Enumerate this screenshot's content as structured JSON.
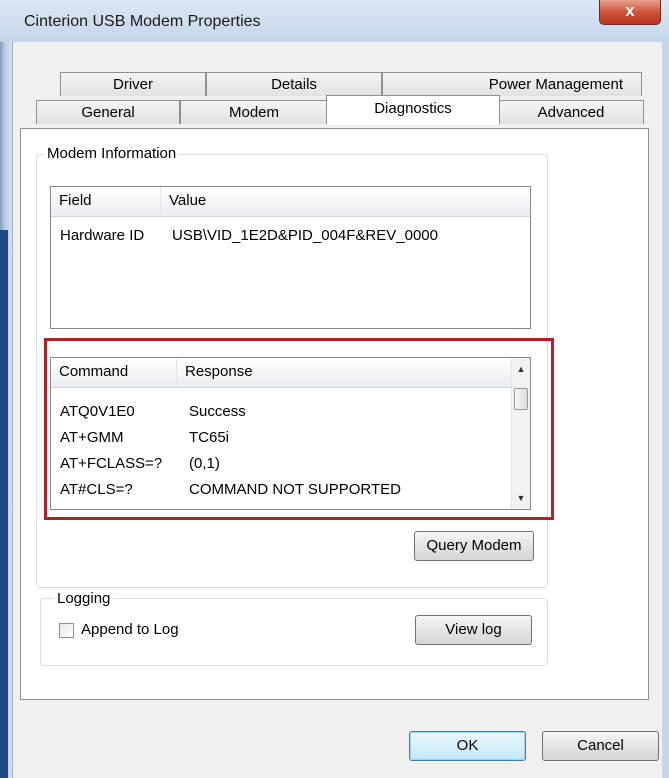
{
  "window": {
    "title": "Cinterion USB Modem Properties",
    "close_glyph": "x"
  },
  "tabs_row1": [
    {
      "label": "Driver"
    },
    {
      "label": "Details"
    },
    {
      "label": "Power Management"
    }
  ],
  "tabs_row2": [
    {
      "label": "General"
    },
    {
      "label": "Modem"
    },
    {
      "label": "Diagnostics"
    },
    {
      "label": "Advanced"
    }
  ],
  "active_tab": "Diagnostics",
  "modem_info": {
    "title": "Modem Information",
    "columns": [
      "Field",
      "Value"
    ],
    "rows": [
      {
        "field": "Hardware ID",
        "value": "USB\\VID_1E2D&PID_004F&REV_0000"
      }
    ]
  },
  "commands": {
    "columns": [
      "Command",
      "Response"
    ],
    "rows": [
      {
        "command": "ATQ0V1E0",
        "response": "Success"
      },
      {
        "command": "AT+GMM",
        "response": "TC65i"
      },
      {
        "command": "AT+FCLASS=?",
        "response": "(0,1)"
      },
      {
        "command": "AT#CLS=?",
        "response": "COMMAND NOT SUPPORTED"
      }
    ],
    "highlight_color": "#b22222"
  },
  "buttons": {
    "query_modem": "Query Modem",
    "view_log": "View log",
    "ok": "OK",
    "cancel": "Cancel"
  },
  "logging": {
    "title": "Logging",
    "append_label": "Append to Log",
    "append_checked": false
  },
  "icons": {
    "scroll_up": "scroll-up-arrow-icon",
    "scroll_down": "scroll-down-arrow-icon"
  }
}
